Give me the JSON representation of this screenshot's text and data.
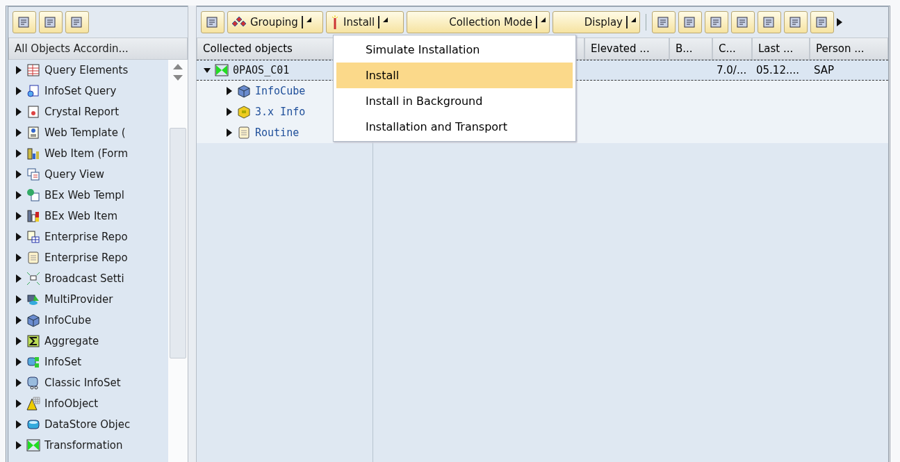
{
  "left_panel": {
    "header": "All Objects Accordin...",
    "items": [
      {
        "label": "Query Elements",
        "expanded": false
      },
      {
        "label": "InfoSet Query",
        "expanded": false
      },
      {
        "label": "Crystal Report",
        "expanded": false
      },
      {
        "label": "Web Template (",
        "expanded": false
      },
      {
        "label": "Web Item (Form",
        "expanded": false
      },
      {
        "label": "Query View",
        "expanded": false
      },
      {
        "label": "BEx Web Templ",
        "expanded": false
      },
      {
        "label": "BEx Web Item",
        "expanded": false
      },
      {
        "label": "Enterprise Repo",
        "expanded": false
      },
      {
        "label": "Enterprise Repo",
        "expanded": false
      },
      {
        "label": "Broadcast Setti",
        "expanded": false
      },
      {
        "label": "MultiProvider",
        "expanded": false
      },
      {
        "label": "InfoCube",
        "expanded": false
      },
      {
        "label": "Aggregate",
        "expanded": false
      },
      {
        "label": "InfoSet",
        "expanded": false
      },
      {
        "label": "Classic InfoSet",
        "expanded": false
      },
      {
        "label": "InfoObject",
        "expanded": false
      },
      {
        "label": "DataStore Objec",
        "expanded": false
      },
      {
        "label": "Transformation",
        "expanded": false
      }
    ]
  },
  "toolbar": {
    "buttons": [
      {
        "label": "Grouping",
        "kind": "menu"
      },
      {
        "label": "Install",
        "kind": "menu"
      },
      {
        "label": "Collection Mode",
        "kind": "menu"
      },
      {
        "label": "Display",
        "kind": "menu"
      }
    ]
  },
  "table": {
    "columns": [
      "Collected objects",
      "Elevated ...",
      "B...",
      "C...",
      "Last ...",
      "Person ..."
    ],
    "rows": [
      {
        "expanded": true,
        "selected": true,
        "cells": [
          "0PAOS_C01",
          "",
          "",
          "7.0/...",
          "05.12....",
          "SAP"
        ],
        "children": [
          {
            "cells": [
              "InfoCube"
            ],
            "expanded": false
          },
          {
            "cells": [
              "3.x Info"
            ],
            "expanded": false
          },
          {
            "cells": [
              "Routine"
            ],
            "expanded": false
          }
        ]
      }
    ]
  },
  "install_menu": {
    "items": [
      {
        "label": "Simulate Installation",
        "selected": false
      },
      {
        "label": "Install",
        "selected": true
      },
      {
        "label": "Install in Background",
        "selected": false
      },
      {
        "label": "Installation and Transport",
        "selected": false
      }
    ]
  }
}
